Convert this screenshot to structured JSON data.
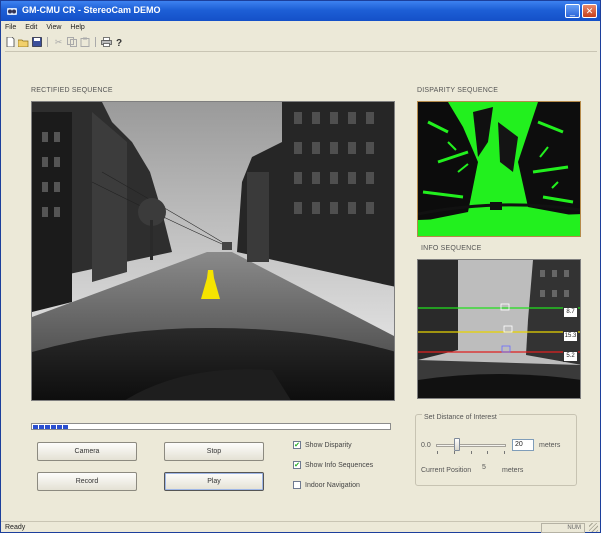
{
  "window": {
    "title": "GM-CMU CR - StereoCam DEMO",
    "controls": {
      "minimize": "_",
      "close": "✕"
    }
  },
  "menu": {
    "items": [
      "File",
      "Edit",
      "View",
      "Help"
    ]
  },
  "toolbar": {
    "icons": [
      "new-file-icon",
      "open-folder-icon",
      "save-icon",
      "cut-icon",
      "copy-icon",
      "paste-icon",
      "print-icon",
      "help-icon"
    ]
  },
  "panels": {
    "rectified": {
      "label": "RECTIFIED SEQUENCE"
    },
    "disparity": {
      "label": "DISPARITY SEQUENCE"
    },
    "info": {
      "label": "INFO SEQUENCE",
      "readouts": [
        "8.7",
        "15.3",
        "5.2"
      ]
    }
  },
  "playback": {
    "progress_blocks": 6
  },
  "buttons": {
    "camera": "Camera",
    "stop": "Stop",
    "record": "Record",
    "play": "Play"
  },
  "options": {
    "show_disparity": {
      "label": "Show Disparity",
      "checked": true
    },
    "show_info": {
      "label": "Show Info Sequences",
      "checked": true
    },
    "indoor_nav": {
      "label": "Indoor Navigation",
      "checked": false
    }
  },
  "distance": {
    "legend": "Set Distance of Interest",
    "min_label": "0.0",
    "value": "20",
    "unit": "meters",
    "position_label": "Current Position",
    "position_value": "5",
    "position_unit": "meters"
  },
  "status": {
    "text": "Ready",
    "indicator": "NUM"
  },
  "colors": {
    "disparity_green": "#22f01e",
    "cone_yellow": "#f5e400",
    "title_blue": "#1d5fd6"
  }
}
